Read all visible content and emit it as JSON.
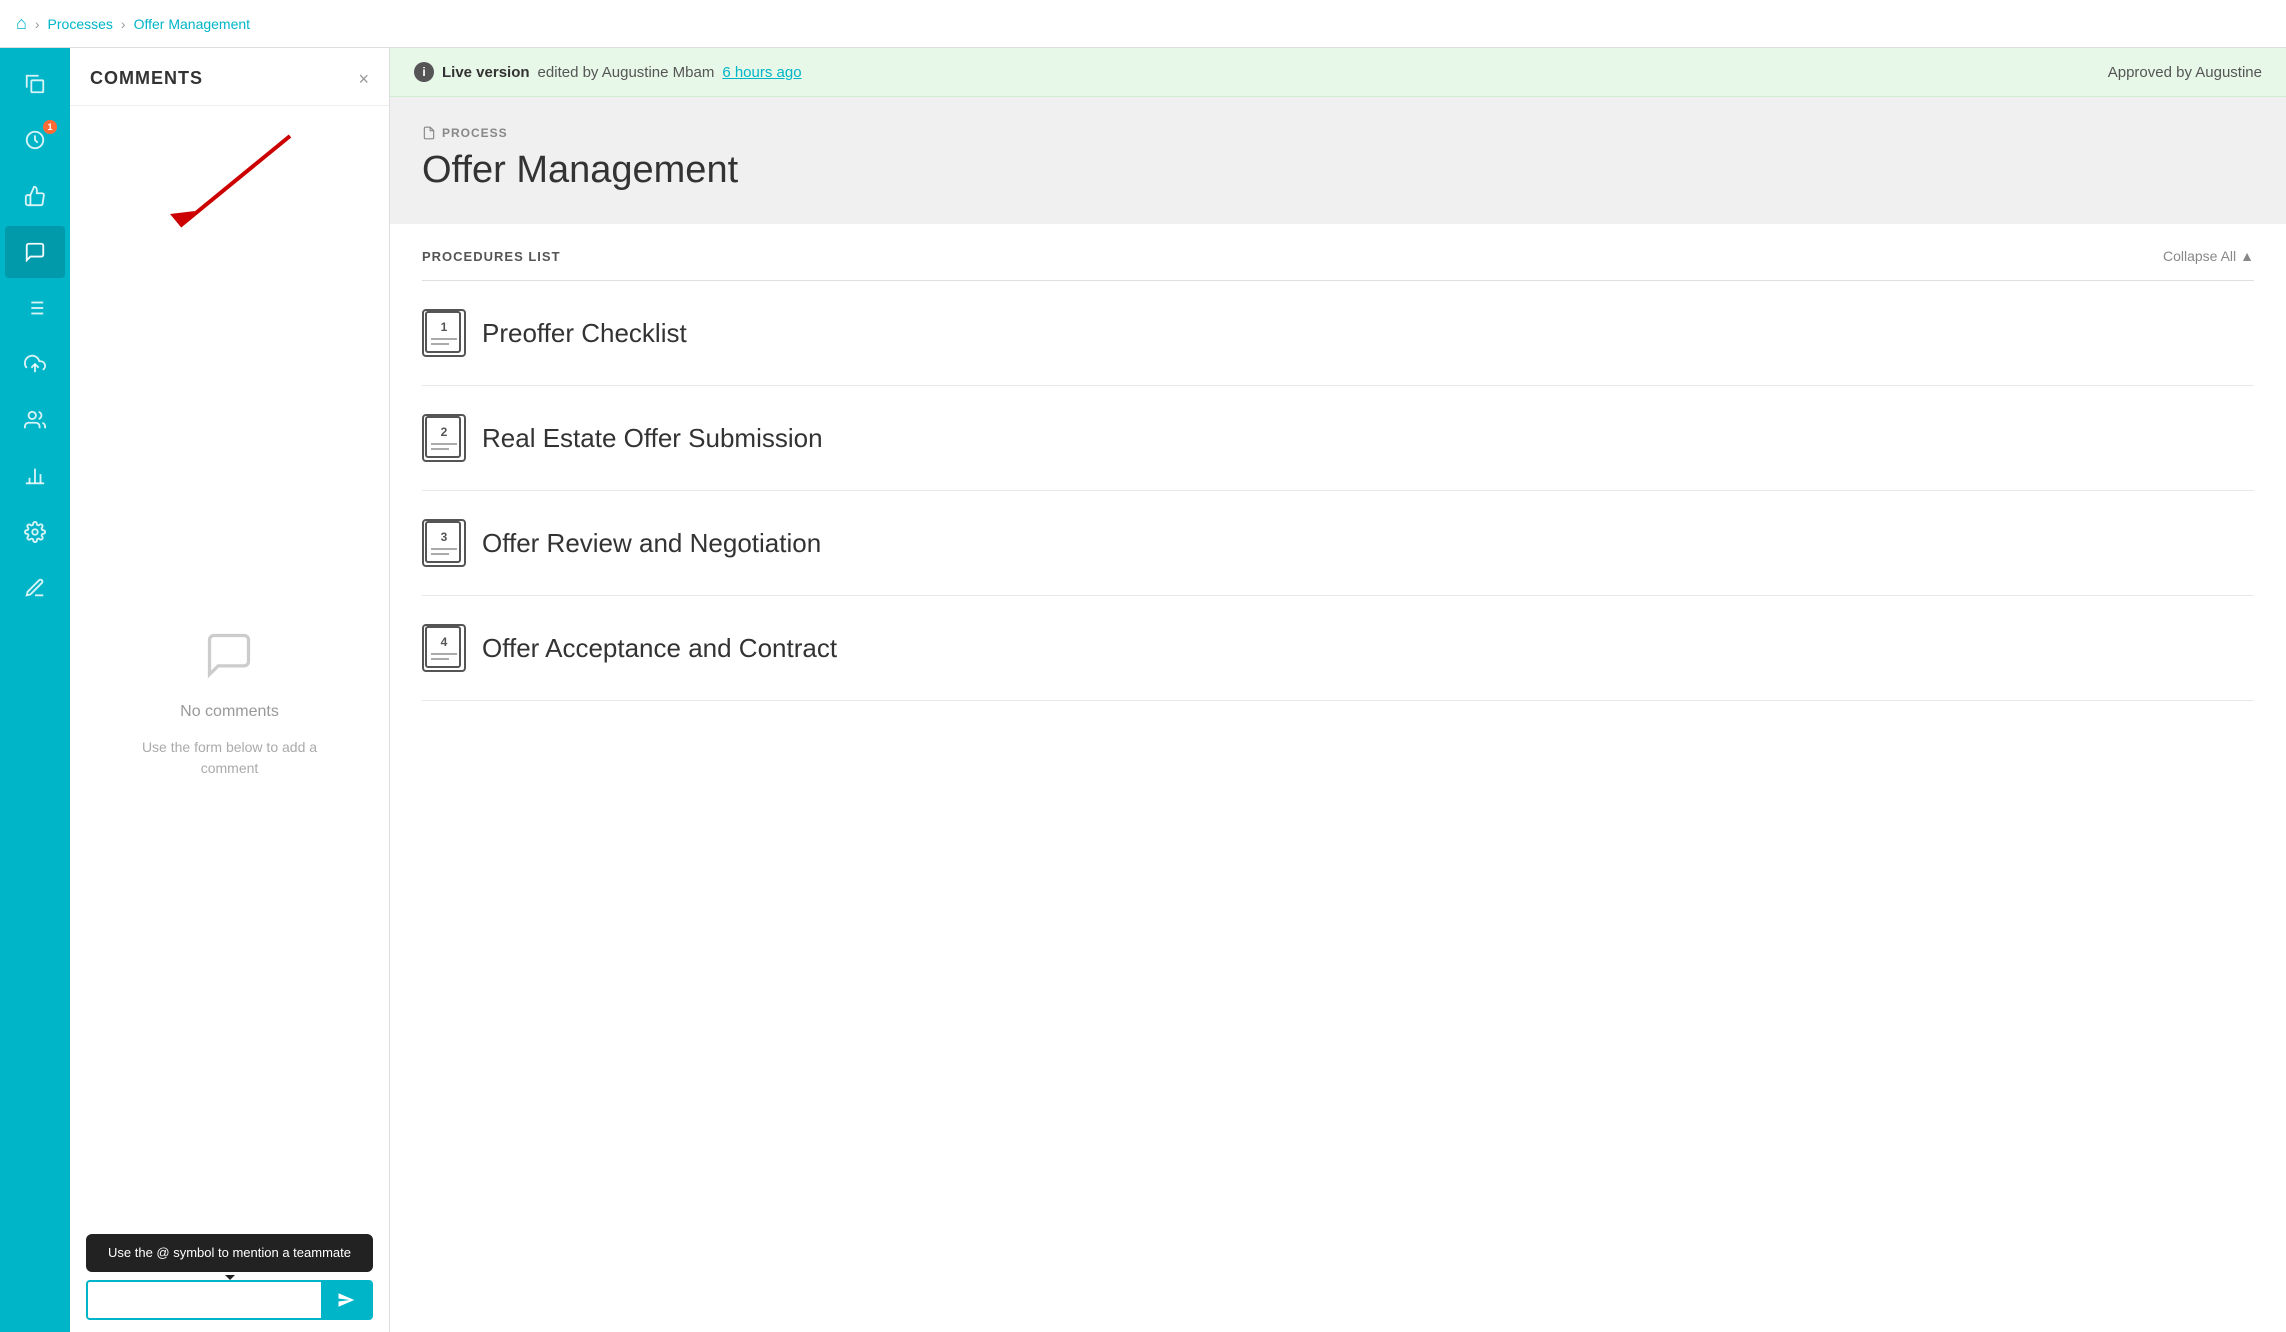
{
  "topNav": {
    "home_icon": "🏠",
    "breadcrumbs": [
      {
        "label": "Processes",
        "active": false
      },
      {
        "label": "Offer Management",
        "active": true
      }
    ],
    "separator": "›"
  },
  "sidebar": {
    "icons": [
      {
        "id": "copy",
        "symbol": "⧉",
        "active": false,
        "badge": null
      },
      {
        "id": "history",
        "symbol": "🕐",
        "active": false,
        "badge": "1"
      },
      {
        "id": "like",
        "symbol": "👍",
        "active": false,
        "badge": null
      },
      {
        "id": "comments",
        "symbol": "💬",
        "active": true,
        "badge": null
      },
      {
        "id": "list",
        "symbol": "☰",
        "active": false,
        "badge": null
      },
      {
        "id": "upload",
        "symbol": "⬆",
        "active": false,
        "badge": null
      },
      {
        "id": "team",
        "symbol": "👥",
        "active": false,
        "badge": null
      },
      {
        "id": "chart",
        "symbol": "📊",
        "active": false,
        "badge": null
      },
      {
        "id": "settings",
        "symbol": "⚙",
        "active": false,
        "badge": null
      },
      {
        "id": "signature",
        "symbol": "✒",
        "active": false,
        "badge": null
      }
    ]
  },
  "commentsPanel": {
    "title": "COMMENTS",
    "close_label": "×",
    "no_comments_text": "No comments",
    "add_comment_hint": "Use the form below to add a\ncomment",
    "tooltip_text": "Use the @ symbol to\nmention a teammate",
    "input_placeholder": "",
    "send_icon": "➤"
  },
  "liveVersionBar": {
    "info_icon": "i",
    "live_version_label": "Live version",
    "edited_by": "edited by Augustine Mbam",
    "time_ago": "6 hours ago",
    "approved_text": "Approved by Augustine"
  },
  "processHeader": {
    "process_label": "PROCESS",
    "process_title": "Offer Management"
  },
  "proceduresList": {
    "header": "PROCEDURES LIST",
    "collapse_all": "Collapse All",
    "collapse_icon": "▲",
    "items": [
      {
        "number": "1",
        "name": "Preoffer Checklist"
      },
      {
        "number": "2",
        "name": "Real Estate Offer Submission"
      },
      {
        "number": "3",
        "name": "Offer Review and Negotiation"
      },
      {
        "number": "4",
        "name": "Offer Acceptance and Contract"
      }
    ]
  }
}
